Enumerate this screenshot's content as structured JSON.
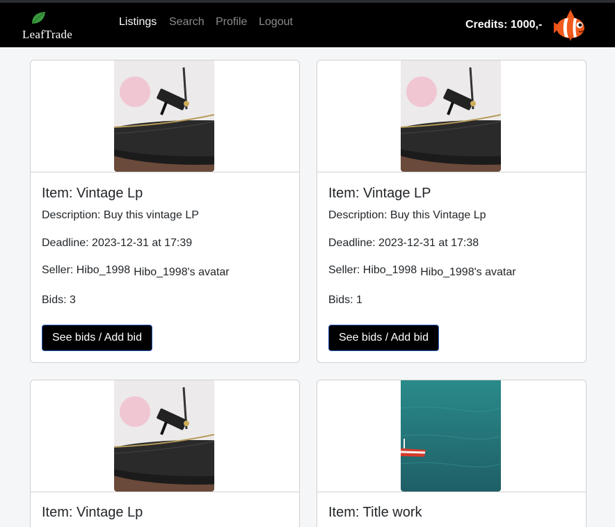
{
  "brand": {
    "name": "LeafTrade",
    "leaf_color": "#2e8b3a"
  },
  "nav": {
    "links": [
      {
        "label": "Listings",
        "active": true
      },
      {
        "label": "Search",
        "active": false
      },
      {
        "label": "Profile",
        "active": false
      },
      {
        "label": "Logout",
        "active": false
      }
    ],
    "credits": "Credits: 1000,-"
  },
  "listings": [
    {
      "title": "Item: Vintage Lp",
      "description": "Description: Buy this vintage LP",
      "deadline": "Deadline: 2023-12-31 at 17:39",
      "seller": "Seller: Hibo_1998",
      "seller_avatar_alt": "Hibo_1998's avatar",
      "bids": "Bids: 3",
      "button": "See bids / Add bid",
      "image": "turntable-image"
    },
    {
      "title": "Item: Vintage LP",
      "description": "Description: Buy this Vintage Lp",
      "deadline": "Deadline: 2023-12-31 at 17:38",
      "seller": "Seller: Hibo_1998",
      "seller_avatar_alt": "Hibo_1998's avatar",
      "bids": "Bids: 1",
      "button": "See bids / Add bid",
      "image": "turntable-image"
    },
    {
      "title": "Item: Vintage Lp",
      "image": "turntable-image"
    },
    {
      "title": "Item: Title work",
      "image": "boat-on-sea-image"
    }
  ]
}
